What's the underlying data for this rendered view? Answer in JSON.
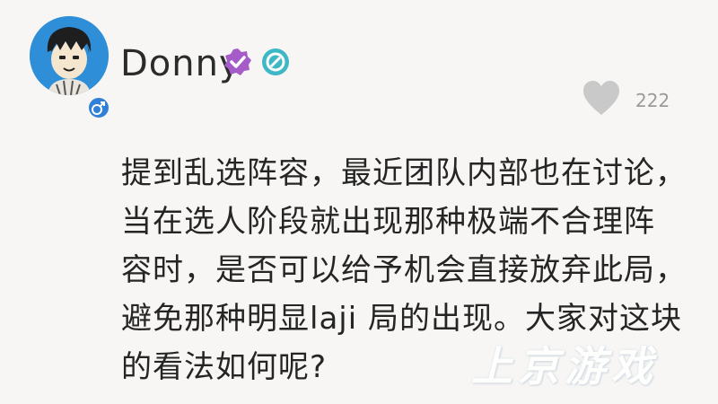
{
  "user": {
    "name": "Donny",
    "avatar_icon": "cartoon-boy-avatar",
    "gender_icon": "male-symbol-icon",
    "verify_icon": "purple-verified-badge-icon",
    "level_icon": "teal-ring-badge-icon"
  },
  "like": {
    "icon": "heart-icon",
    "count": "222"
  },
  "post": {
    "lines": [
      "提到乱选阵容，最近团队内部也在讨论，",
      "当在选人阶段就出现那种极端不合理阵",
      "容时，是否可以给予机会直接放弃此局，",
      "避免那种明显laji 局的出现。大家对这块",
      "的看法如何呢?"
    ]
  },
  "watermark": {
    "text": "上京游戏"
  },
  "colors": {
    "avatar_bg": "#2e8fd8",
    "verify": "#a55cc9",
    "level": "#3fb8c6",
    "heart": "#c9c9c9",
    "text": "#252525",
    "muted": "#9a9a9a"
  }
}
